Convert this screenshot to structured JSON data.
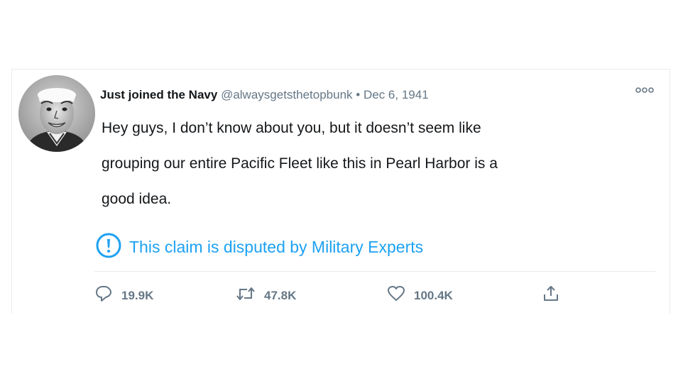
{
  "tweet": {
    "display_name": "Just joined the Navy",
    "handle": "@alwaysgetsthetopbunk",
    "separator": "•",
    "date": "Dec 6, 1941",
    "text_lines": [
      "Hey guys, I don’t know about you, but it doesn’t seem like",
      "grouping our entire Pacific Fleet like this in Pearl Harbor is a",
      "good idea."
    ],
    "disputed_notice": "This claim is disputed by Military Experts",
    "actions": {
      "reply_count": "19.9K",
      "retweet_count": "47.8K",
      "like_count": "100.4K"
    }
  },
  "icons": [
    "more-icon",
    "warning-icon",
    "reply-icon",
    "retweet-icon",
    "like-icon",
    "share-icon"
  ],
  "colors": {
    "accent": "#1da1f2",
    "secondary_text": "#657786",
    "primary_text": "#14171a",
    "border": "#e6ecf0"
  }
}
